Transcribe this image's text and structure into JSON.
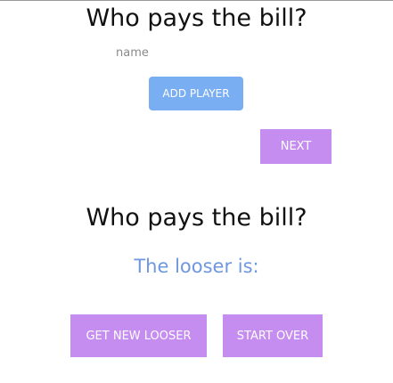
{
  "players_section": {
    "title": "Who pays the bill?",
    "name_placeholder": "name",
    "add_player_label": "ADD PLAYER",
    "next_label": "NEXT"
  },
  "result_section": {
    "title": "Who pays the bill?",
    "looser_text": "The looser is:",
    "get_new_looser_label": "GET NEW LOOSER",
    "start_over_label": "START OVER"
  },
  "colors": {
    "primary_blue": "#7aaef3",
    "accent_purple": "#c58df0",
    "result_text_blue": "#6f97e0"
  }
}
